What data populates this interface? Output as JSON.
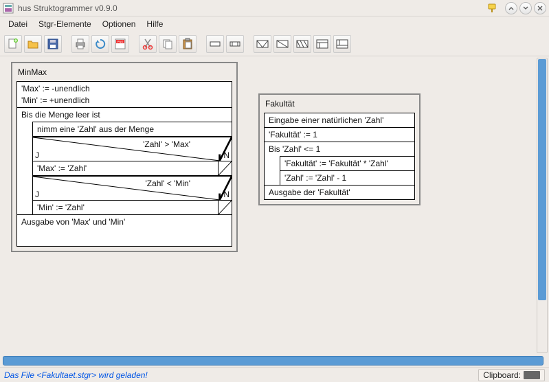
{
  "window": {
    "title": "hus Struktogrammer v0.9.0"
  },
  "menu": {
    "file": "Datei",
    "elements": "Stgr-Elemente",
    "options": "Optionen",
    "help": "Hilfe"
  },
  "status": {
    "message": "Das File <Fakultaet.stgr> wird geladen!",
    "clipboard_label": "Clipboard:"
  },
  "minmax": {
    "title": "MinMax",
    "l1": "'Max' := -unendlich",
    "l2": "'Min' := +unendlich",
    "loop": "Bis die Menge leer ist",
    "pick": "nimm eine 'Zahl' aus der Menge",
    "cond1": "'Zahl' > 'Max'",
    "j": "J",
    "n": "N",
    "assign1": "'Max' := 'Zahl'",
    "cond2": "'Zahl' < 'Min'",
    "assign2": "'Min' := 'Zahl'",
    "out": "Ausgabe von 'Max' und 'Min'"
  },
  "fak": {
    "title": "Fakultät",
    "l1": "Eingabe einer natürlichen 'Zahl'",
    "l2": "'Fakultät' := 1",
    "loop": "Bis 'Zahl' <= 1",
    "a1": "'Fakultät' := 'Fakultät' * 'Zahl'",
    "a2": "'Zahl' := 'Zahl' - 1",
    "out": "Ausgabe der 'Fakultät'"
  }
}
